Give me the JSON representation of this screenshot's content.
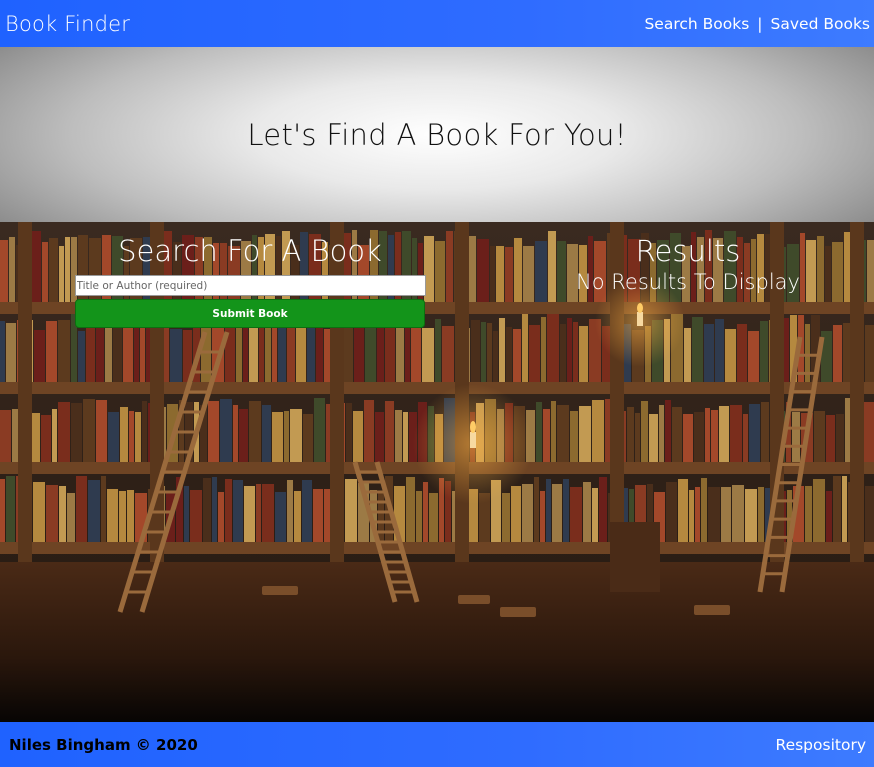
{
  "navbar": {
    "brand": "Book Finder",
    "links": [
      "Search Books",
      "Saved Books"
    ],
    "separator": "|"
  },
  "hero": {
    "title": "Let's Find A Book For You!"
  },
  "search": {
    "heading": "Search For A Book",
    "input_value": "",
    "placeholder": "Title or Author (required)",
    "submit_label": "Submit Book"
  },
  "results": {
    "heading": "Results",
    "empty_message": "No Results To Display"
  },
  "footer": {
    "copyright": "Niles Bingham © 2020",
    "repo_link": "Respository"
  },
  "colors": {
    "nav_blue": "#2f6cff",
    "submit_green": "#13941a"
  },
  "icons": {
    "background": "library-bookshelves-image"
  }
}
